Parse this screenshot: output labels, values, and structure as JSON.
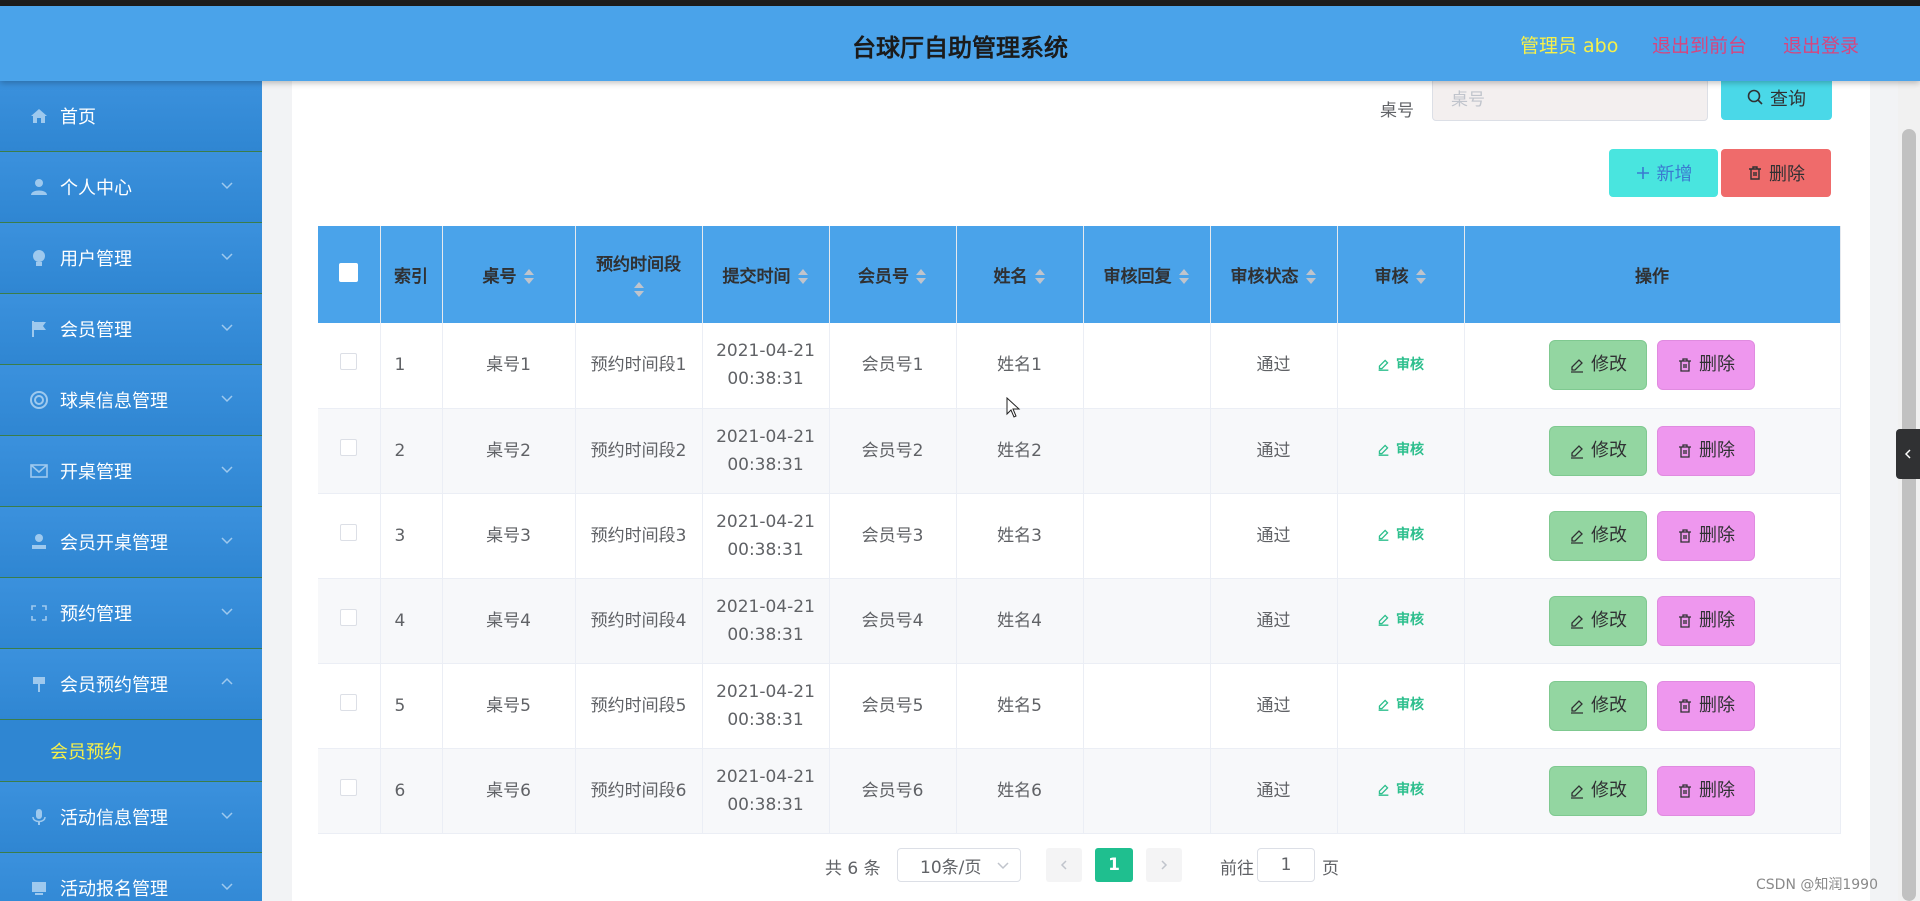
{
  "header": {
    "title": "台球厅自助管理系统",
    "admin_label": "管理员 abo",
    "front_label": "退出到前台",
    "logout_label": "退出登录"
  },
  "sidebar": {
    "items": [
      {
        "label": "首页",
        "icon": "home-icon"
      },
      {
        "label": "个人中心",
        "icon": "user-icon"
      },
      {
        "label": "用户管理",
        "icon": "bulb-icon"
      },
      {
        "label": "会员管理",
        "icon": "flag-icon"
      },
      {
        "label": "球桌信息管理",
        "icon": "life-ring-icon"
      },
      {
        "label": "开桌管理",
        "icon": "mail-icon"
      },
      {
        "label": "会员开桌管理",
        "icon": "person-icon"
      },
      {
        "label": "预约管理",
        "icon": "frame-icon"
      },
      {
        "label": "会员预约管理",
        "icon": "pin-icon"
      },
      {
        "label": "活动信息管理",
        "icon": "mic-icon"
      },
      {
        "label": "活动报名管理",
        "icon": "monitor-icon"
      }
    ],
    "sub_item": "会员预约"
  },
  "search": {
    "label": "桌号",
    "placeholder": "桌号",
    "button": "查询"
  },
  "actions": {
    "add": "新增",
    "delete": "删除"
  },
  "table": {
    "columns": [
      "索引",
      "桌号",
      "预约时间段",
      "提交时间",
      "会员号",
      "姓名",
      "审核回复",
      "审核状态",
      "审核",
      "操作"
    ],
    "audit_link": "审核",
    "edit_label": "修改",
    "delete_label": "删除",
    "rows": [
      {
        "index": "1",
        "table_no": "桌号1",
        "slot": "预约时间段1",
        "date": "2021-04-21",
        "time": "00:38:31",
        "member_no": "会员号1",
        "name": "姓名1",
        "reply": "",
        "status": "通过"
      },
      {
        "index": "2",
        "table_no": "桌号2",
        "slot": "预约时间段2",
        "date": "2021-04-21",
        "time": "00:38:31",
        "member_no": "会员号2",
        "name": "姓名2",
        "reply": "",
        "status": "通过"
      },
      {
        "index": "3",
        "table_no": "桌号3",
        "slot": "预约时间段3",
        "date": "2021-04-21",
        "time": "00:38:31",
        "member_no": "会员号3",
        "name": "姓名3",
        "reply": "",
        "status": "通过"
      },
      {
        "index": "4",
        "table_no": "桌号4",
        "slot": "预约时间段4",
        "date": "2021-04-21",
        "time": "00:38:31",
        "member_no": "会员号4",
        "name": "姓名4",
        "reply": "",
        "status": "通过"
      },
      {
        "index": "5",
        "table_no": "桌号5",
        "slot": "预约时间段5",
        "date": "2021-04-21",
        "time": "00:38:31",
        "member_no": "会员号5",
        "name": "姓名5",
        "reply": "",
        "status": "通过"
      },
      {
        "index": "6",
        "table_no": "桌号6",
        "slot": "预约时间段6",
        "date": "2021-04-21",
        "time": "00:38:31",
        "member_no": "会员号6",
        "name": "姓名6",
        "reply": "",
        "status": "通过"
      }
    ]
  },
  "pagination": {
    "total": "共 6 条",
    "page_size": "10条/页",
    "current_page": "1",
    "goto_label": "前往",
    "goto_value": "1",
    "page_word": "页"
  },
  "watermark": "CSDN @知润1990",
  "colors": {
    "header_bg": "#4aa3ea",
    "sidebar_bg": "#2f86d2",
    "accent_yellow": "#f7f049",
    "accent_pink": "#d7457f",
    "active_page": "#1fbf8f"
  }
}
